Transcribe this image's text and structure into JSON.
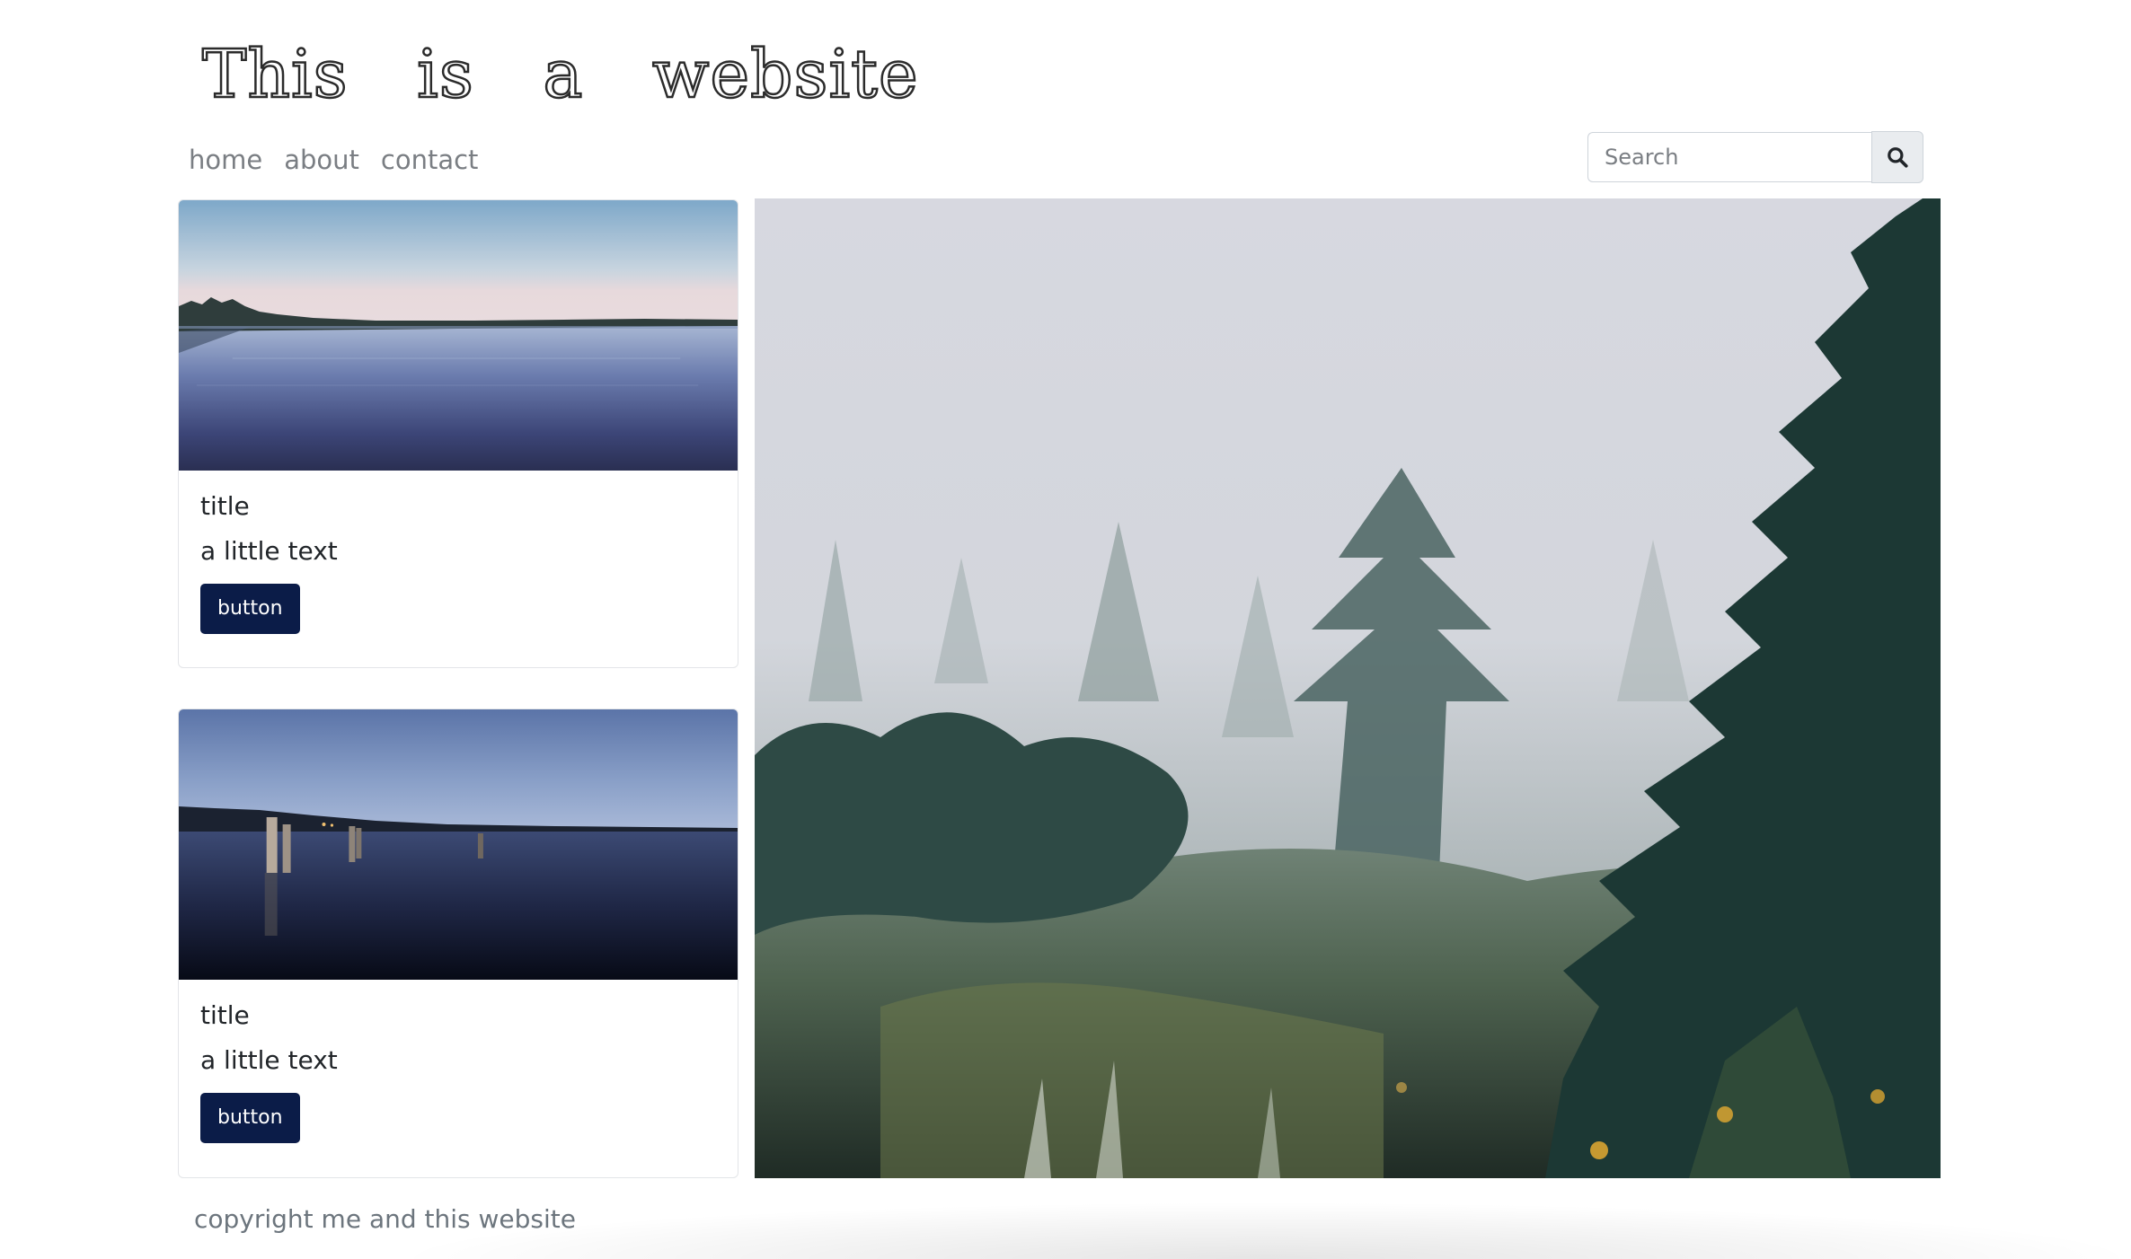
{
  "header": {
    "title": "This is a website"
  },
  "nav": {
    "items": [
      {
        "label": "home"
      },
      {
        "label": "about"
      },
      {
        "label": "contact"
      }
    ]
  },
  "search": {
    "placeholder": "Search",
    "value": "",
    "icon": "search-icon"
  },
  "cards": [
    {
      "image": "lake-at-dusk",
      "title": "title",
      "text": "a little text",
      "button_label": "button"
    },
    {
      "image": "lake-with-posts-at-night",
      "title": "title",
      "text": "a little text",
      "button_label": "button"
    }
  ],
  "hero": {
    "image": "foggy-forest"
  },
  "footer": {
    "text": "copyright me and this website"
  },
  "colors": {
    "button_bg": "#0b1c48",
    "nav_text": "#7a7e83",
    "footer_text": "#6c757d"
  }
}
